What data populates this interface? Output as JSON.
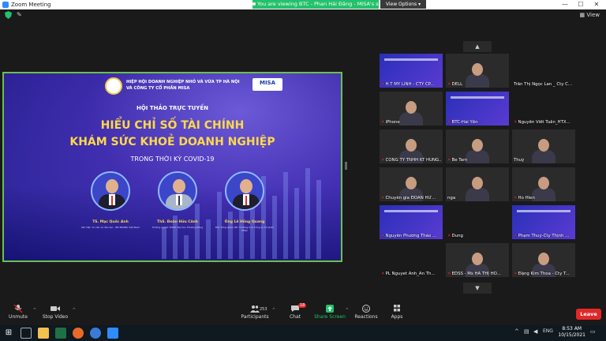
{
  "window": {
    "title": "Zoom Meeting"
  },
  "banner": {
    "text": "You are viewing BTC - Phan Hải Đăng - MISA's screen",
    "view_options": "View Options ▾"
  },
  "view_label": "View",
  "slide": {
    "org_line1": "HIỆP HỘI DOANH NGHIỆP NHỎ VÀ VỪA TP HÀ NỘI",
    "org_line2": "VÀ CÔNG TY CỔ PHẦN MISA",
    "brand": "MISA",
    "event": "HỘI THẢO TRỰC TUYẾN",
    "title1": "HIỂU CHỈ SỐ TÀI CHÍNH",
    "title2": "KHÁM SỨC KHOẺ DOANH NGHIỆP",
    "title3": "TRONG THỜI KỲ COVID-19",
    "speakers": [
      {
        "name": "TS. Mạc Quốc Anh",
        "desc": "GĐ Viện Tư vấn và đào tạo - BN MSMEs Việt Nam"
      },
      {
        "name": "ThS. Đoàn Hữu Cảnh",
        "desc": "Trưởng ngành TCDN, Đại học Phương Đông"
      },
      {
        "name": "Ông Lê Hồng Quang",
        "desc": "Phó Tổng Giám đốc Thường trực Công ty Cổ phần MISA"
      }
    ]
  },
  "participants_grid": [
    {
      "name": "H.T MY LINH - CTY CP...",
      "kind": "slide",
      "muted": true
    },
    {
      "name": "DELL",
      "kind": "video",
      "muted": true
    },
    {
      "name": "Trần Thị Ngọc Lan _ Cty C...",
      "kind": "blank",
      "muted": false
    },
    {
      "name": "iPhone",
      "kind": "video",
      "muted": true
    },
    {
      "name": "BTC-Hải Yến",
      "kind": "slide",
      "muted": true
    },
    {
      "name": "Nguyễn Viết Tuấn_HTX...",
      "kind": "blank",
      "muted": true
    },
    {
      "name": "CONG TY TNHH KT HUNG...",
      "kind": "video",
      "muted": true
    },
    {
      "name": "Be Tam",
      "kind": "video",
      "muted": true
    },
    {
      "name": "Thuý",
      "kind": "video",
      "muted": false
    },
    {
      "name": "Chuyên gia ĐOÀN HỮ...",
      "kind": "video",
      "muted": true
    },
    {
      "name": "nga",
      "kind": "video",
      "muted": false
    },
    {
      "name": "Ho Hien",
      "kind": "video",
      "muted": true
    },
    {
      "name": "Nguyễn Phương Thảo ...",
      "kind": "slide",
      "muted": true
    },
    {
      "name": "Dung",
      "kind": "blank",
      "muted": true
    },
    {
      "name": "Phạm Thuý-Cty Thịnh ...",
      "kind": "slide",
      "muted": true
    },
    {
      "name": "PL Nguyet Anh_An Th...",
      "kind": "blank",
      "muted": true
    },
    {
      "name": "EDSS - Ms HÀ THỊ HO...",
      "kind": "video",
      "muted": true
    },
    {
      "name": "Đặng Kim Thoa - Cty T...",
      "kind": "video",
      "muted": true
    }
  ],
  "toolbar": {
    "unmute": "Unmute",
    "stop_video": "Stop Video",
    "participants": "Participants",
    "participants_count": "253",
    "chat": "Chat",
    "chat_badge": "18",
    "share_screen": "Share Screen",
    "reactions": "Reactions",
    "apps": "Apps",
    "leave": "Leave"
  },
  "taskbar": {
    "time": "8:53 AM",
    "date": "10/15/2021"
  },
  "colors": {
    "green": "#23c16b",
    "accent": "#2d8cff",
    "leave": "#e02828"
  }
}
